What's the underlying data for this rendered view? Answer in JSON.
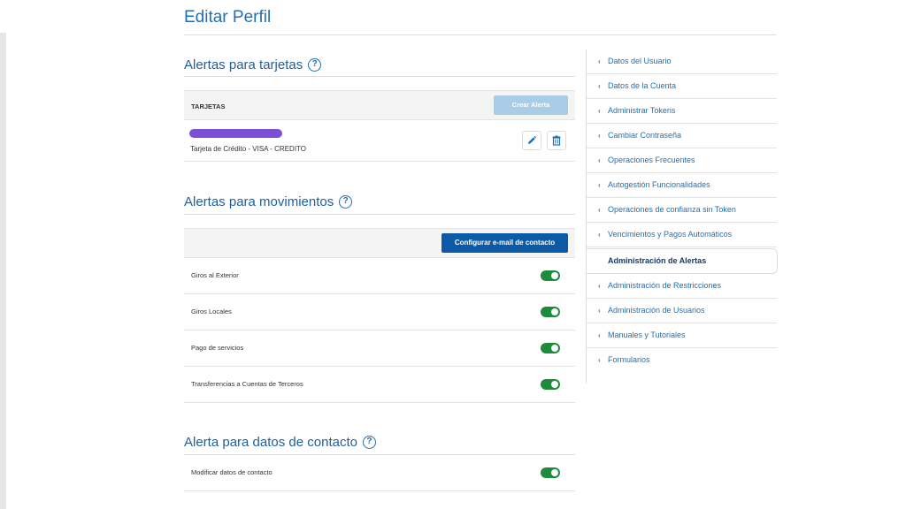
{
  "page": {
    "title": "Editar Perfil"
  },
  "cards_section": {
    "title": "Alertas para tarjetas",
    "help_icon": "?",
    "header_label": "TARJETAS",
    "create_button": "Crear Alerta",
    "card": {
      "description": "Tarjeta de Crédito - VISA - CREDITO",
      "mask_color": "#7b4fd6"
    }
  },
  "movements_section": {
    "title": "Alertas para movimientos",
    "help_icon": "?",
    "configure_button": "Configurar e-mail de contacto",
    "alerts": [
      {
        "label": "Giros al Exterior",
        "enabled": true
      },
      {
        "label": "Giros Locales",
        "enabled": true
      },
      {
        "label": "Pago de servicios",
        "enabled": true
      },
      {
        "label": "Transferencias a Cuentas de Terceros",
        "enabled": true
      }
    ]
  },
  "contact_section": {
    "title": "Alerta para datos de contacto",
    "help_icon": "?",
    "alerts": [
      {
        "label": "Modificar datos de contacto",
        "enabled": true
      }
    ]
  },
  "sidebar": {
    "items": [
      {
        "label": "Datos del Usuario"
      },
      {
        "label": "Datos de la Cuenta"
      },
      {
        "label": "Administrar Tokens"
      },
      {
        "label": "Cambiar Contraseña"
      },
      {
        "label": "Operaciones Frecuentes"
      },
      {
        "label": "Autogestión Funcionalidades"
      },
      {
        "label": "Operaciones de confianza sin Token"
      },
      {
        "label": "Vencimientos y Pagos Automáticos"
      },
      {
        "label": "Administración de Alertas",
        "active": true
      },
      {
        "label": "Administración de Restricciones"
      },
      {
        "label": "Administración de Usuarios"
      },
      {
        "label": "Manuales y Tutoriales"
      },
      {
        "label": "Formularios"
      }
    ],
    "chevron": "‹"
  },
  "colors": {
    "primary": "#0c5aa6",
    "title_blue": "#1f6fb7",
    "toggle_on": "#1e8a3c",
    "disabled_button": "#a9cde6"
  },
  "icons": {
    "edit": "pencil-icon",
    "delete": "trash-icon",
    "help": "question-circle-icon",
    "chevron": "chevron-left-icon"
  }
}
